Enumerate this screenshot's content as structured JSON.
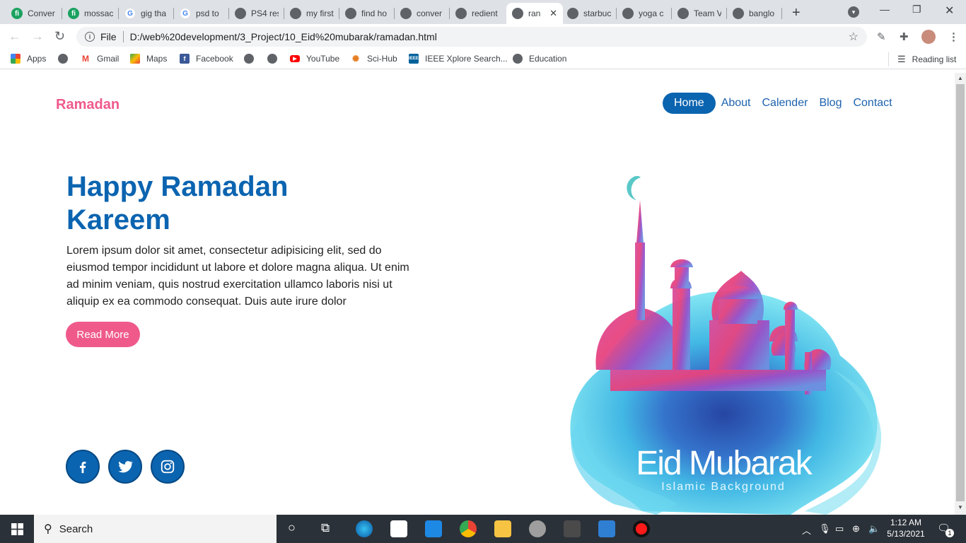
{
  "browser": {
    "tabs": [
      {
        "title": "Conver",
        "icon": "fiverr"
      },
      {
        "title": "mossac",
        "icon": "fiverr"
      },
      {
        "title": "gig tha",
        "icon": "google"
      },
      {
        "title": "psd to",
        "icon": "google"
      },
      {
        "title": "PS4 res",
        "icon": "globe"
      },
      {
        "title": "my first",
        "icon": "globe"
      },
      {
        "title": "find ho",
        "icon": "globe"
      },
      {
        "title": "conver",
        "icon": "globe"
      },
      {
        "title": "redient",
        "icon": "globe"
      },
      {
        "title": "ran",
        "icon": "globe",
        "active": true
      },
      {
        "title": "starbuc",
        "icon": "globe"
      },
      {
        "title": "yoga c",
        "icon": "globe"
      },
      {
        "title": "Team V",
        "icon": "globe"
      },
      {
        "title": "banglo",
        "icon": "globe"
      }
    ],
    "address": {
      "scheme_label": "File",
      "url": "D:/web%20development/3_Project/10_Eid%20mubarak/ramadan.html"
    },
    "bookmarks": [
      {
        "label": "Apps",
        "icon": "apps"
      },
      {
        "label": "",
        "icon": "globe"
      },
      {
        "label": "Gmail",
        "icon": "gmail"
      },
      {
        "label": "Maps",
        "icon": "maps"
      },
      {
        "label": "Facebook",
        "icon": "facebook"
      },
      {
        "label": "",
        "icon": "globe"
      },
      {
        "label": "",
        "icon": "globe"
      },
      {
        "label": "YouTube",
        "icon": "youtube"
      },
      {
        "label": "Sci-Hub",
        "icon": "scihub"
      },
      {
        "label": "IEEE Xplore Search...",
        "icon": "ieee"
      },
      {
        "label": "Education",
        "icon": "globe"
      }
    ],
    "reading_list": "Reading list"
  },
  "page": {
    "brand": "Ramadan",
    "nav": [
      {
        "label": "Home",
        "active": true
      },
      {
        "label": "About"
      },
      {
        "label": "Calender"
      },
      {
        "label": "Blog"
      },
      {
        "label": "Contact"
      }
    ],
    "hero": {
      "title_line1": "Happy Ramadan",
      "title_line2": "Kareem",
      "text": "Lorem ipsum dolor sit amet, consectetur adipisicing elit, sed do eiusmod tempor incididunt ut labore et dolore magna aliqua. Ut enim ad minim veniam, quis nostrud exercitation ullamco laboris nisi ut aliquip ex ea commodo consequat. Duis aute irure dolor",
      "button": "Read More"
    },
    "social": [
      "facebook-icon",
      "twitter-icon",
      "instagram-icon"
    ],
    "artwork": {
      "heading": "Eid Mubarak",
      "subheading": "Islamic Background"
    },
    "colors": {
      "brand_pink": "#ef5a8b",
      "primary_blue": "#0b64b0"
    }
  },
  "taskbar": {
    "search_label": "Search",
    "time": "1:12 AM",
    "date": "5/13/2021",
    "notification_count": "1"
  }
}
